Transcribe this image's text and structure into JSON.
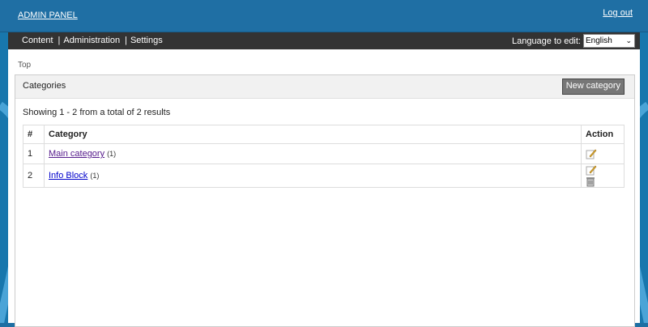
{
  "header": {
    "brand": "ADMIN PANEL",
    "logout": "Log out"
  },
  "nav": {
    "items": [
      {
        "label": "Content",
        "sep": "|"
      },
      {
        "label": "Administration",
        "sep": "|"
      },
      {
        "label": "Settings",
        "sep": ""
      }
    ],
    "language_label": "Language to edit:",
    "language_value": "English"
  },
  "breadcrumb": "Top",
  "panel": {
    "title": "Categories",
    "new_button": "New category"
  },
  "summary": "Showing 1 - 2 from a total of 2 results",
  "table": {
    "headers": [
      "#",
      "Category",
      "Action"
    ],
    "rows": [
      {
        "num": "1",
        "name": "Main category",
        "count": "(1)"
      },
      {
        "num": "2",
        "name": "Info Block",
        "count": "(1)"
      }
    ]
  },
  "colors": {
    "header_bg": "#1f6fa4",
    "nav_bg": "#333333",
    "button_bg": "#777777"
  }
}
